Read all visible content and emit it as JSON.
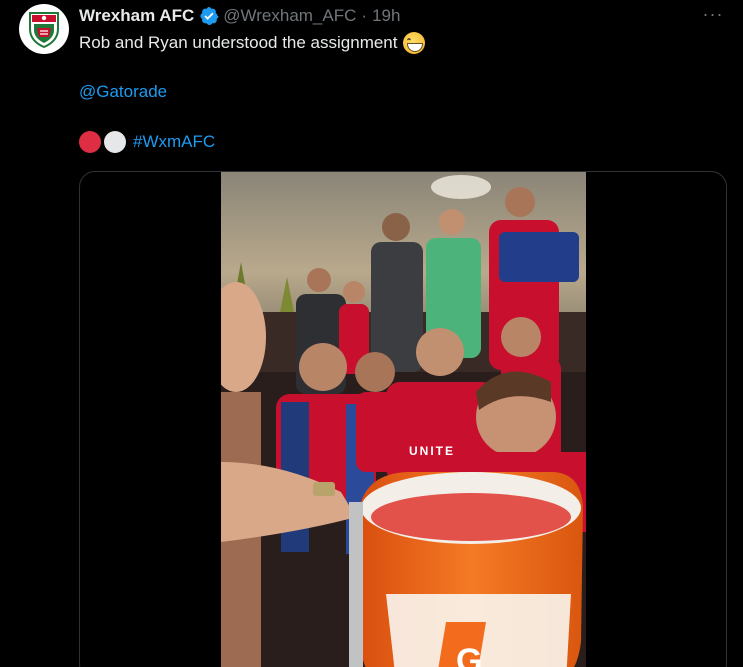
{
  "tweet": {
    "author_name": "Wrexham AFC",
    "author_handle": "@Wrexham_AFC",
    "separator": "·",
    "time": "19h",
    "more_label": "···",
    "text_line1": "Rob and Ryan understood the assignment",
    "mention": "@Gatorade",
    "hashtag": "#WxmAFC"
  },
  "icons": {
    "avatar": "wrexham-crest-icon",
    "verified": "verified-badge-icon",
    "more": "more-options-icon",
    "emoji_line1": "grinning-squinting-face-emoji",
    "emoji_circles": [
      "red-circle-emoji",
      "white-circle-emoji"
    ]
  },
  "media": {
    "type": "video",
    "description_visible_text": [
      "UNITE",
      "G"
    ]
  },
  "colors": {
    "background": "#000000",
    "text": "#e7e9ea",
    "secondary": "#71767b",
    "link": "#1d9bf0",
    "verified": "#1d9bf0",
    "kit_red": "#c8102e",
    "gatorade_orange": "#f36b1c"
  }
}
